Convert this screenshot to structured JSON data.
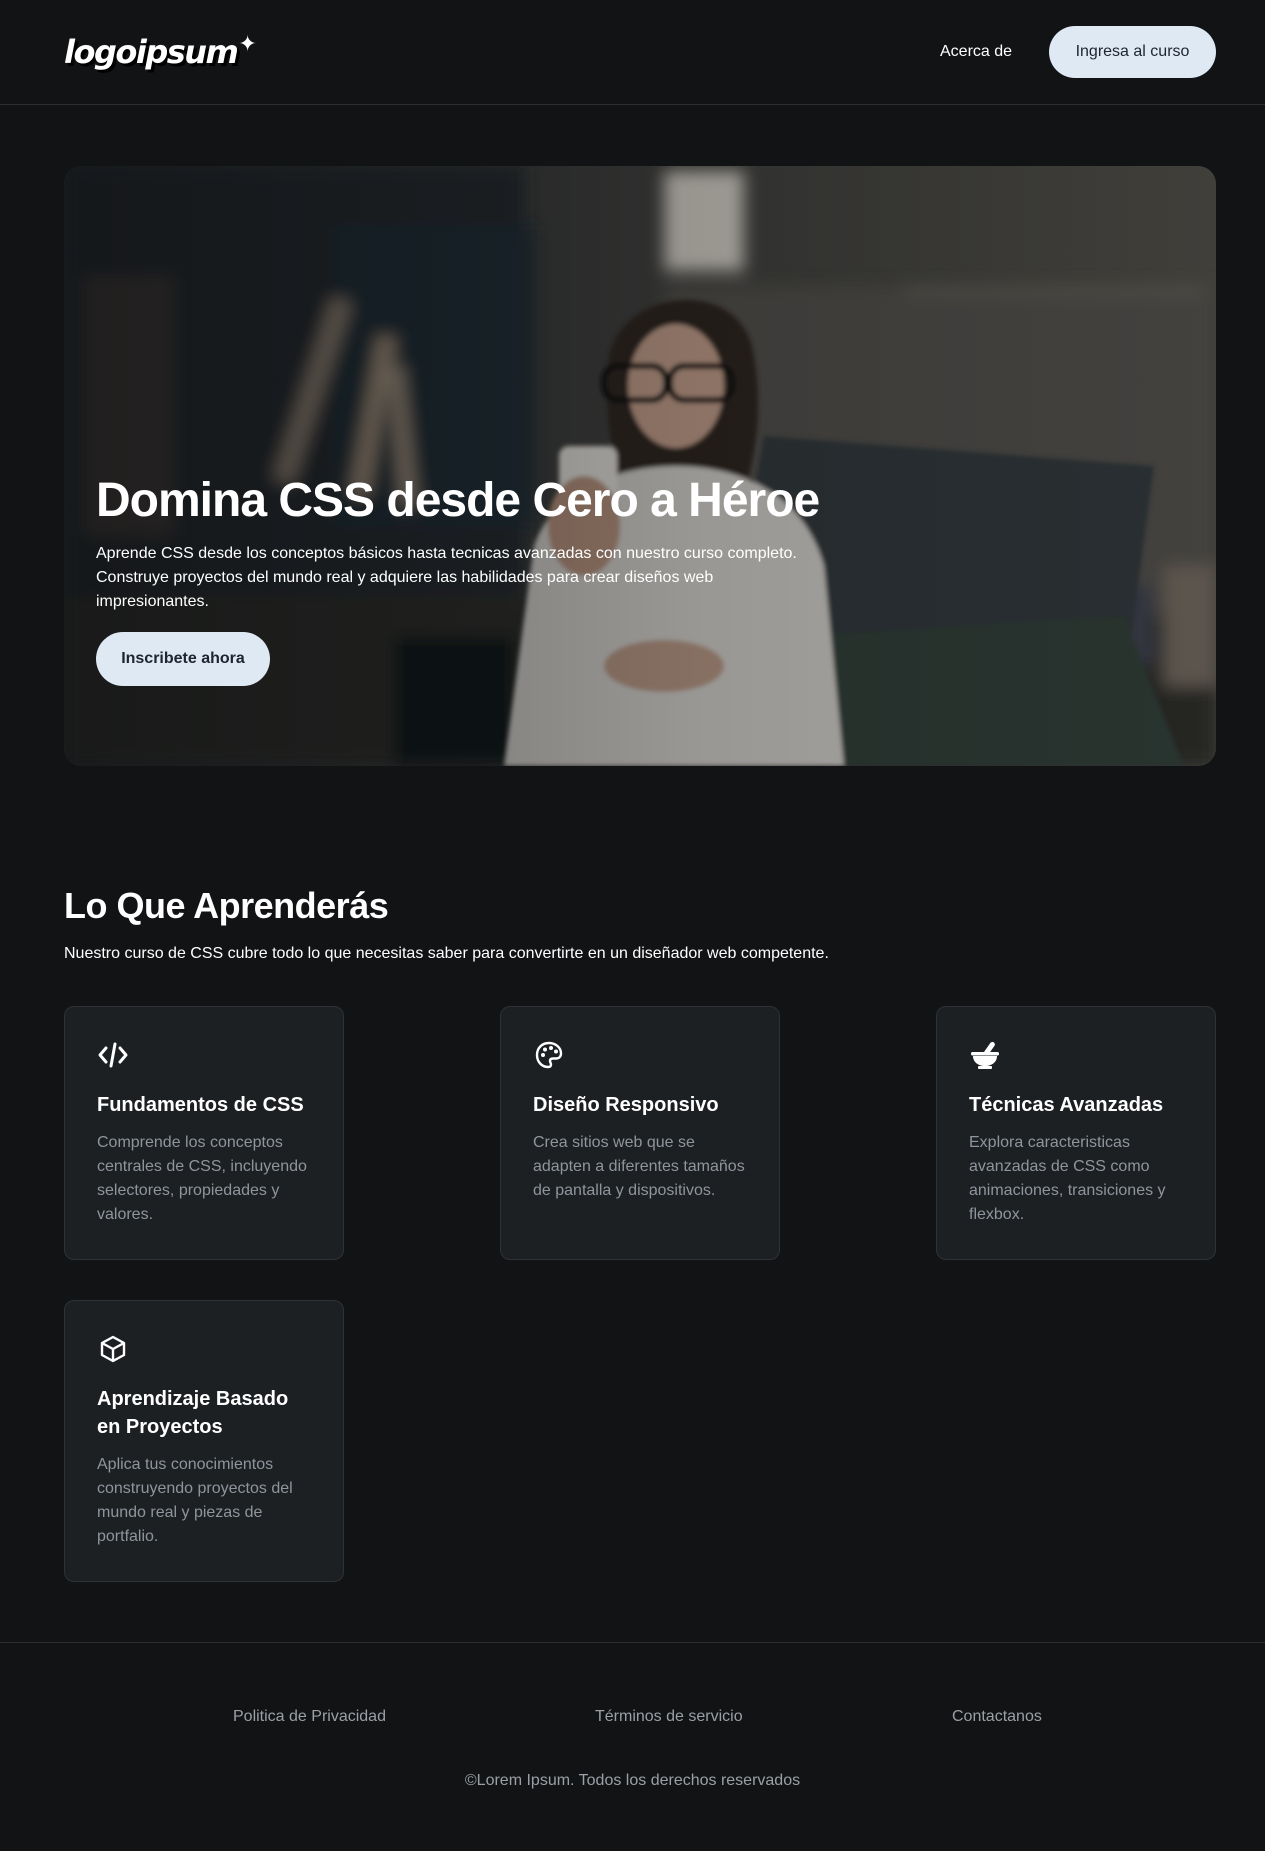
{
  "header": {
    "logo_text": "logoipsum",
    "nav_about": "Acerca de",
    "cta_label": "Ingresa al curso"
  },
  "hero": {
    "title": "Domina CSS desde Cero a Héroe",
    "text": "Aprende CSS desde los conceptos básicos hasta tecnicas avanzadas con nuestro curso completo. Construye proyectos del mundo real y adquiere las habilidades para crear diseños web impresionantes.",
    "cta_label": "Inscribete ahora"
  },
  "learn": {
    "title": "Lo Que Aprenderás",
    "subtitle": "Nuestro curso de CSS cubre todo lo que necesitas saber para convertirte en un diseñador web competente.",
    "cards": [
      {
        "icon": "code-icon",
        "title": "Fundamentos de CSS",
        "text": "Comprende los conceptos centrales de CSS, incluyendo selectores, propiedades y valores."
      },
      {
        "icon": "palette-icon",
        "title": "Diseño Responsivo",
        "text": "Crea sitios web que se adapten a diferentes tamaños de pantalla y dispositivos."
      },
      {
        "icon": "mortar-pestle-icon",
        "title": "Técnicas Avanzadas",
        "text": "Explora caracteristicas avanzadas de CSS como animaciones, transiciones y flexbox."
      },
      {
        "icon": "cube-icon",
        "title": "Aprendizaje Basado en Proyectos",
        "text": "Aplica tus conocimientos construyendo proyectos del mundo real y piezas de portfalio."
      }
    ]
  },
  "footer": {
    "links": [
      "Politica de Privacidad",
      "Términos de servicio",
      "Contactanos"
    ],
    "copyright": "©Lorem Ipsum. Todos los derechos reservados"
  }
}
